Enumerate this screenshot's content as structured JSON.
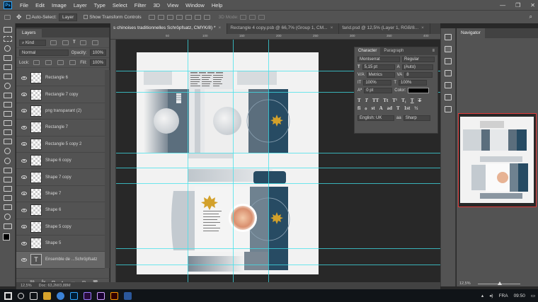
{
  "app": {
    "logo": "Ps",
    "menu": [
      "File",
      "Edit",
      "Image",
      "Layer",
      "Type",
      "Select",
      "Filter",
      "3D",
      "View",
      "Window",
      "Help"
    ],
    "window_controls": {
      "minimize": "—",
      "restore": "❐",
      "close": "✕"
    }
  },
  "options_bar": {
    "auto_select_label": "Auto-Select:",
    "auto_select_value": "Layer",
    "show_transform_label": "Show Transform Controls",
    "mode_3d_label": "3D Mode:"
  },
  "layers_panel": {
    "tab": "Layers",
    "filter_label": "Kind",
    "blend_mode": "Normal",
    "opacity_label": "Opacity:",
    "opacity_value": "100%",
    "lock_label": "Lock:",
    "fill_label": "Fill:",
    "fill_value": "100%",
    "layers": [
      {
        "name": "Rectangle 6",
        "type": "raster"
      },
      {
        "name": "Rectangle 7 copy",
        "type": "raster"
      },
      {
        "name": "png transparant (2)",
        "type": "raster"
      },
      {
        "name": "Rectangle 7",
        "type": "raster"
      },
      {
        "name": "Rectangle 5 copy 2",
        "type": "raster"
      },
      {
        "name": "Shape 6 copy",
        "type": "raster"
      },
      {
        "name": "Shape 7 copy",
        "type": "raster"
      },
      {
        "name": "Shape 7",
        "type": "raster"
      },
      {
        "name": "Shape 6",
        "type": "raster"
      },
      {
        "name": "Shape 5 copy",
        "type": "raster"
      },
      {
        "name": "Shape 5",
        "type": "raster"
      },
      {
        "name": "Ensemble de ...Schröpfsatz",
        "type": "text"
      }
    ],
    "footer_icons": [
      "link-icon",
      "fx-icon",
      "mask-icon",
      "adjustment-icon",
      "group-icon",
      "new-layer-icon",
      "trash-icon"
    ],
    "footer_glyphs": [
      "⛓",
      "fx",
      "◘",
      "◐",
      "▭",
      "⊞",
      "🗑"
    ]
  },
  "doc_tabs": [
    {
      "label": "s chinoises traditionnelles  Schröpfsatz, CMYK/8) *",
      "active": true
    },
    {
      "label": "Rectangle 4 copy.psb @ 66,7% (Group 1, CM...",
      "active": false
    },
    {
      "label": "farid.psd @ 12,5% (Layer 1, RGB/8...",
      "active": false
    }
  ],
  "tab_close": "×",
  "ruler_ticks": [
    "50",
    "100",
    "150",
    "200",
    "250",
    "300",
    "350",
    "400"
  ],
  "status": {
    "zoom": "12,5%",
    "doc": "Doc: 63,2M/3,88M"
  },
  "character_panel": {
    "tabs": [
      "Character",
      "Paragraph"
    ],
    "font_family": "Montserrat",
    "font_style": "Regular",
    "font_size": "5,15 pt",
    "leading": "(Auto)",
    "kerning": "Metrics",
    "tracking": "8",
    "vertical_scale": "100%",
    "horizontal_scale": "100%",
    "baseline_shift": "0 pt",
    "color_label": "Color:",
    "typo_buttons": [
      "T",
      "T",
      "TT",
      "Tt",
      "T¹",
      "T₁",
      "T",
      "T"
    ],
    "ot_buttons": [
      "fi",
      "ℴ",
      "st",
      "A",
      "ad",
      "T",
      "1st",
      "½"
    ],
    "language": "English: UK",
    "aa_symbol": "aa",
    "antialias": "Sharp"
  },
  "navigator": {
    "tab": "Navigator",
    "zoom": "12,5%"
  },
  "taskbar": {
    "language": "FRA",
    "time": "09:50",
    "apps": [
      "start-icon",
      "search-icon",
      "task-view-icon",
      "explorer-icon",
      "browser-icon",
      "photoshop-icon",
      "premiere-icon",
      "aftereffects-icon",
      "illustrator-icon",
      "word-icon"
    ]
  },
  "colors": {
    "accent_guides": "#3fe0ea",
    "box_navy": "#274b63",
    "box_slate": "#5b6e7d",
    "gold_leaf": "#d3a12b",
    "nav_frame": "#e03a3a"
  }
}
